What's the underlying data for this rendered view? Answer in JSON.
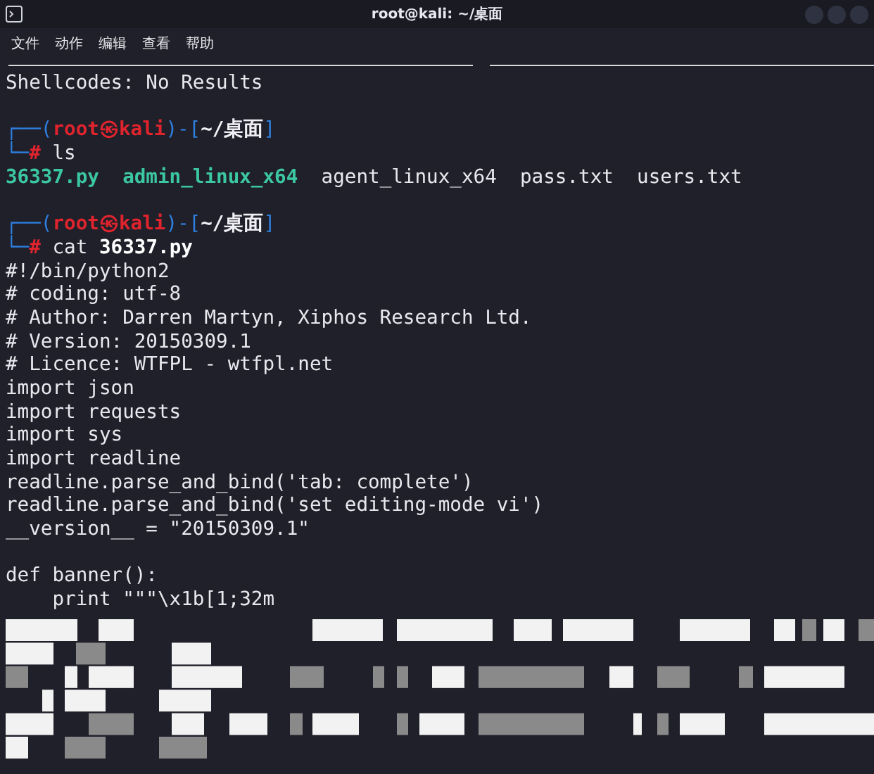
{
  "window": {
    "title": "root@kali: ~/桌面"
  },
  "menu": [
    "文件",
    "动作",
    "编辑",
    "查看",
    "帮助"
  ],
  "terminal": {
    "lines": [
      {
        "kind": "text",
        "parts": [
          {
            "text": "Shellcodes: No Results",
            "kind": "plain"
          }
        ]
      },
      {
        "kind": "blank"
      },
      {
        "kind": "text",
        "parts": [
          {
            "text": "┌──(",
            "kind": "frame"
          },
          {
            "text": "root㉿kali",
            "kind": "user"
          },
          {
            "text": ")-[",
            "kind": "frame"
          },
          {
            "text": "~/桌面",
            "kind": "path"
          },
          {
            "text": "]",
            "kind": "frame"
          }
        ]
      },
      {
        "kind": "text",
        "parts": [
          {
            "text": "└─",
            "kind": "frame"
          },
          {
            "text": "#",
            "kind": "user"
          },
          {
            "text": " ls",
            "kind": "cmd"
          }
        ]
      },
      {
        "kind": "text",
        "parts": [
          {
            "text": "36337.py",
            "kind": "exec"
          },
          {
            "text": "  admin_linux_x64",
            "kind": "exec"
          },
          {
            "text": "  agent_linux_x64  pass.txt  users.txt",
            "kind": "plain"
          }
        ]
      },
      {
        "kind": "blank"
      },
      {
        "kind": "text",
        "parts": [
          {
            "text": "┌──(",
            "kind": "frame"
          },
          {
            "text": "root㉿kali",
            "kind": "user"
          },
          {
            "text": ")-[",
            "kind": "frame"
          },
          {
            "text": "~/桌面",
            "kind": "path"
          },
          {
            "text": "]",
            "kind": "frame"
          }
        ]
      },
      {
        "kind": "text",
        "parts": [
          {
            "text": "└─",
            "kind": "frame"
          },
          {
            "text": "#",
            "kind": "user"
          },
          {
            "text": " cat ",
            "kind": "cmd"
          },
          {
            "text": "36337.py",
            "kind": "arg"
          }
        ]
      },
      {
        "kind": "text",
        "parts": [
          {
            "text": "#!/bin/python2",
            "kind": "plain"
          }
        ]
      },
      {
        "kind": "text",
        "parts": [
          {
            "text": "# coding: utf-8",
            "kind": "plain"
          }
        ]
      },
      {
        "kind": "text",
        "parts": [
          {
            "text": "# Author: Darren Martyn, Xiphos Research Ltd.",
            "kind": "plain"
          }
        ]
      },
      {
        "kind": "text",
        "parts": [
          {
            "text": "# Version: 20150309.1",
            "kind": "plain"
          }
        ]
      },
      {
        "kind": "text",
        "parts": [
          {
            "text": "# Licence: WTFPL - wtfpl.net",
            "kind": "plain"
          }
        ]
      },
      {
        "kind": "text",
        "parts": [
          {
            "text": "import json",
            "kind": "plain"
          }
        ]
      },
      {
        "kind": "text",
        "parts": [
          {
            "text": "import requests",
            "kind": "plain"
          }
        ]
      },
      {
        "kind": "text",
        "parts": [
          {
            "text": "import sys",
            "kind": "plain"
          }
        ]
      },
      {
        "kind": "text",
        "parts": [
          {
            "text": "import readline",
            "kind": "plain"
          }
        ]
      },
      {
        "kind": "text",
        "parts": [
          {
            "text": "readline.parse_and_bind('tab: complete')",
            "kind": "plain"
          }
        ]
      },
      {
        "kind": "text",
        "parts": [
          {
            "text": "readline.parse_and_bind('set editing-mode vi')",
            "kind": "plain"
          }
        ]
      },
      {
        "kind": "text",
        "parts": [
          {
            "text": "__version__ = \"20150309.1\"",
            "kind": "plain"
          }
        ]
      },
      {
        "kind": "blank"
      },
      {
        "kind": "text",
        "parts": [
          {
            "text": "def banner():",
            "kind": "plain"
          }
        ]
      },
      {
        "kind": "text",
        "parts": [
          {
            "text": "    print \"\"\"\\x1b[1;32m",
            "kind": "plain"
          }
        ]
      },
      {
        "kind": "art"
      }
    ]
  }
}
